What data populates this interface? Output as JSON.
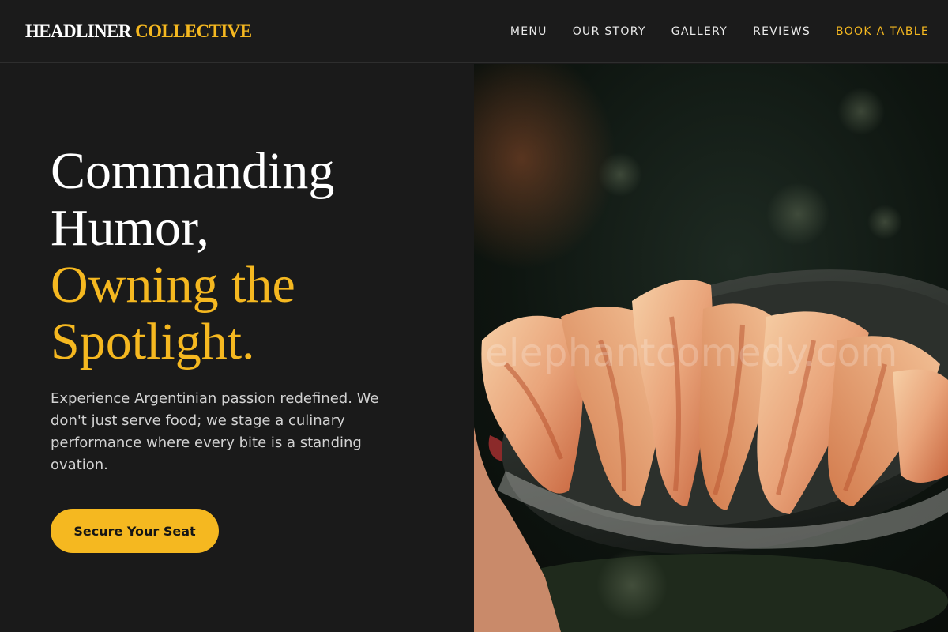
{
  "brand": {
    "part1": "HEADLINER",
    "part2": "COLLECTIVE"
  },
  "nav": {
    "menu": "MENU",
    "story": "OUR STORY",
    "gallery": "GALLERY",
    "reviews": "REVIEWS",
    "book": "BOOK A TABLE"
  },
  "hero": {
    "line1": "Commanding",
    "line2": "Humor,",
    "line3": "Owning the",
    "line4": "Spotlight.",
    "description": "Experience Argentinian passion redefined. We don't just serve food; we stage a culinary performance where every bite is a standing ovation.",
    "cta": "Secure Your Seat"
  },
  "image": {
    "watermark": "elephantcomedy.com",
    "icon": "empanadas-photo"
  },
  "colors": {
    "accent": "#f5b820",
    "background": "#1a1a1a",
    "text": "#ffffff",
    "muted_text": "#d2d2d2"
  }
}
